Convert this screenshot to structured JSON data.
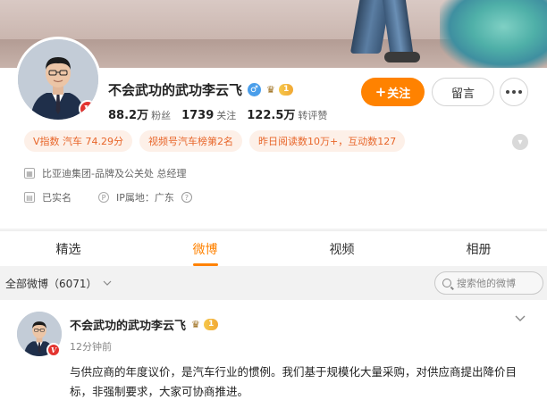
{
  "profile": {
    "name": "不会武功的武功李云飞",
    "gender_symbol": "♂",
    "vip_level": "1",
    "verified_badge": "V",
    "stats": [
      {
        "value": "88.2万",
        "label": "粉丝"
      },
      {
        "value": "1739",
        "label": "关注"
      },
      {
        "value": "122.5万",
        "label": "转评赞"
      }
    ],
    "tags": [
      "V指数 汽车 74.29分",
      "视频号汽车榜第2名",
      "昨日阅读数10万+，互动数127"
    ],
    "company": "比亚迪集团-品牌及公关处 总经理",
    "realname": "已实名",
    "ip_location": "IP属地：广东"
  },
  "actions": {
    "follow_label": "关注",
    "message_label": "留言"
  },
  "tabs": [
    "精选",
    "微博",
    "视频",
    "相册"
  ],
  "active_tab_index": 1,
  "filter": {
    "all_label": "全部微博（6071）",
    "search_placeholder": "搜索他的微博"
  },
  "post": {
    "author": "不会武功的武功李云飞",
    "vip_level": "1",
    "time": "12分钟前",
    "text": "与供应商的年度议价，是汽车行业的惯例。我们基于规模化大量采购，对供应商提出降价目标，非强制要求，大家可协商推进。"
  },
  "colors": {
    "accent": "#ff8200",
    "tag_text": "#e8662a",
    "tag_bg": "#fdf0e8"
  }
}
